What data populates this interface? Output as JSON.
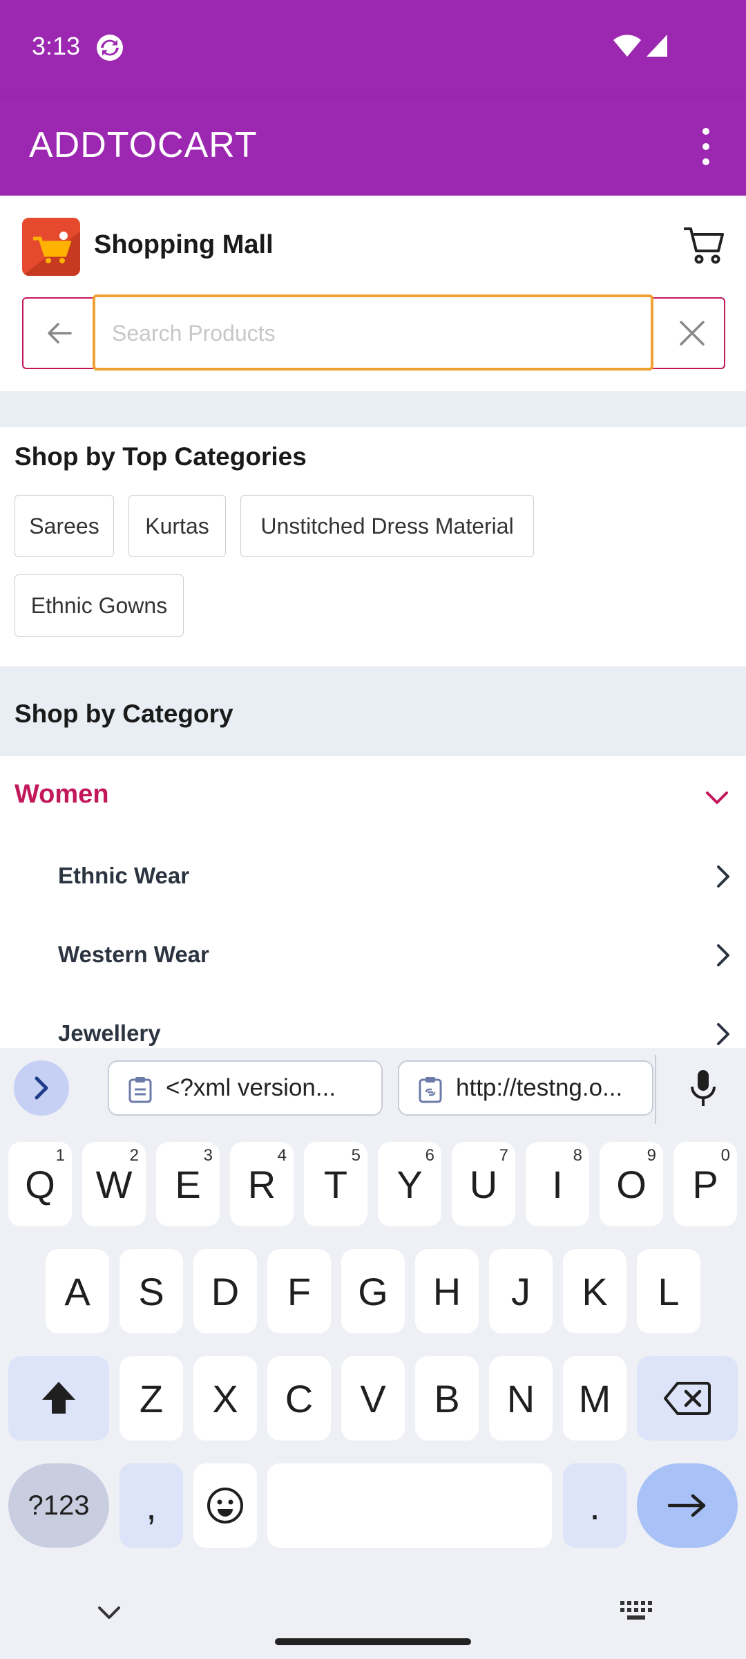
{
  "status_bar": {
    "time": "3:13"
  },
  "app_bar": {
    "title": "ADDTOCART"
  },
  "store": {
    "name": "Shopping Mall"
  },
  "search": {
    "placeholder": "Search Products",
    "value": ""
  },
  "top_categories": {
    "heading": "Shop by Top Categories",
    "chips": [
      "Sarees",
      "Kurtas",
      "Unstitched Dress Material",
      "Ethnic Gowns"
    ]
  },
  "category": {
    "heading": "Shop by Category",
    "expanded": "Women",
    "subcategories": [
      "Ethnic Wear",
      "Western Wear",
      "Jewellery"
    ]
  },
  "keyboard": {
    "clipboard": [
      "<?xml version...",
      "http://testng.o..."
    ],
    "row1": [
      {
        "key": "Q",
        "hint": "1"
      },
      {
        "key": "W",
        "hint": "2"
      },
      {
        "key": "E",
        "hint": "3"
      },
      {
        "key": "R",
        "hint": "4"
      },
      {
        "key": "T",
        "hint": "5"
      },
      {
        "key": "Y",
        "hint": "6"
      },
      {
        "key": "U",
        "hint": "7"
      },
      {
        "key": "I",
        "hint": "8"
      },
      {
        "key": "O",
        "hint": "9"
      },
      {
        "key": "P",
        "hint": "0"
      }
    ],
    "row2": [
      "A",
      "S",
      "D",
      "F",
      "G",
      "H",
      "J",
      "K",
      "L"
    ],
    "row3": [
      "Z",
      "X",
      "C",
      "V",
      "B",
      "N",
      "M"
    ],
    "symbols_label": "?123",
    "comma": ",",
    "period": "."
  },
  "colors": {
    "primary": "#9c27b0",
    "accent": "#c2185b",
    "focus": "#f0a030"
  }
}
